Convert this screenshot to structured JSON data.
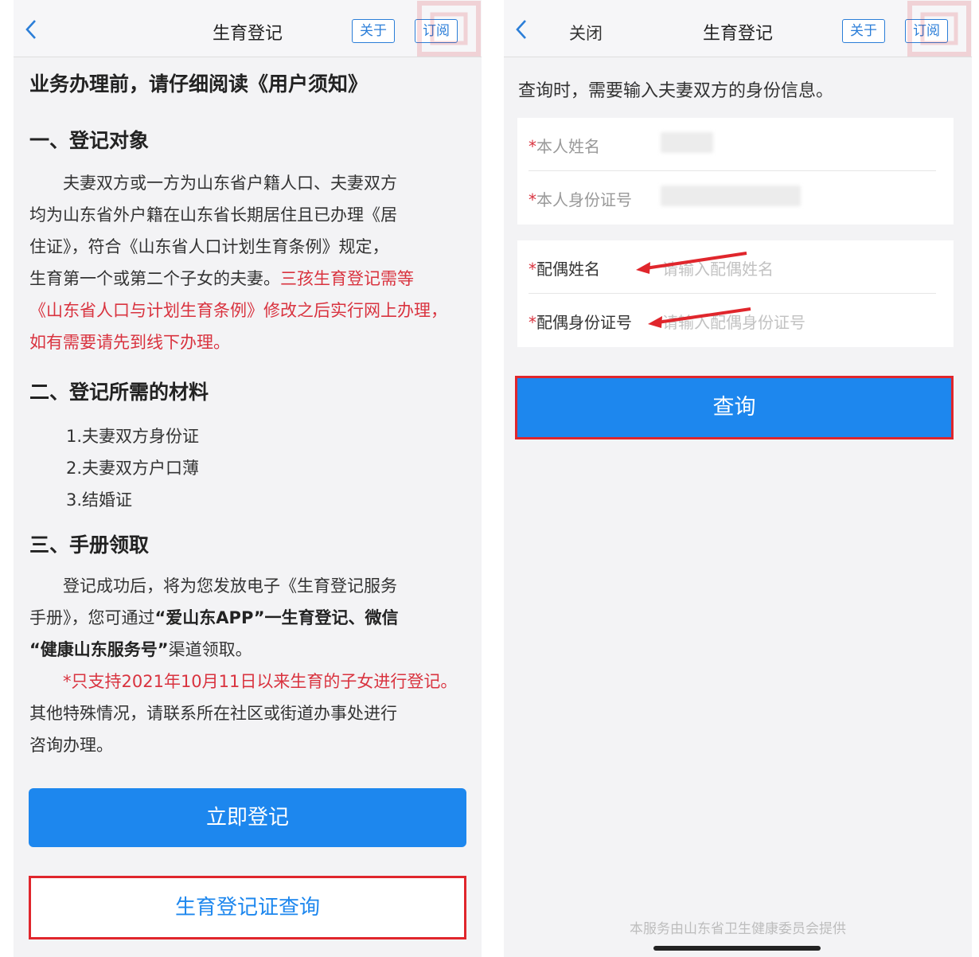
{
  "left": {
    "nav": {
      "title": "生育登记",
      "about": "关于",
      "subscribe": "订阅"
    },
    "notice_title": "业务办理前，请仔细阅读《用户须知》",
    "section1": {
      "title": "一、登记对象",
      "lines": [
        "　　夫妻双方或一方为山东省户籍人口、夫妻双方",
        "均为山东省外户籍在山东省长期居住且已办理《居",
        "住证》，符合《山东省人口计划生育条例》规定，"
      ],
      "line4_normal": "生育第一个或第二个子女的夫妻。",
      "line4_red": "三孩生育登记需等",
      "red_lines": [
        "《山东省人口与计划生育条例》修改之后实行网上办理，",
        "如有需要请先到线下办理。"
      ]
    },
    "section2": {
      "title": "二、登记所需的材料",
      "items": [
        "1.夫妻双方身份证",
        "2.夫妻双方户口薄",
        "3.结婚证"
      ]
    },
    "section3": {
      "title": "三、手册领取",
      "line1": "　　登记成功后，将为您发放电子《生育登记服务",
      "line2_a": "手册》，您可通过",
      "line2_b": "“爱山东APP”一生育登记、微信",
      "line3_b": "“健康山东服务号”",
      "line3_a": "渠道领取。",
      "red_note": "　　*只支持2021年10月11日以来生育的子女进行登记。",
      "line5": "其他特殊情况，请联系所在社区或街道办事处进行",
      "line6": "咨询办理。"
    },
    "register_button": "立即登记",
    "query_cert_button": "生育登记证查询"
  },
  "right": {
    "nav": {
      "close": "关闭",
      "title": "生育登记",
      "about": "关于",
      "subscribe": "订阅"
    },
    "hint": "查询时，需要输入夫妻双方的身份信息。",
    "fields": {
      "self_name_label": "本人姓名",
      "self_id_label": "本人身份证号",
      "spouse_name_label": "配偶姓名",
      "spouse_name_placeholder": "请输入配偶姓名",
      "spouse_id_label": "配偶身份证号",
      "spouse_id_placeholder": "请输入配偶身份证号",
      "required_mark": "*"
    },
    "query_button": "查询",
    "footer": "本服务由山东省卫生健康委员会提供"
  },
  "colors": {
    "primary": "#1d87ee",
    "highlight_border": "#e0262c",
    "notice_red": "#d9333f"
  },
  "icons": [
    "back-arrow-icon",
    "seal-watermark-icon",
    "annotation-arrow-icon"
  ]
}
